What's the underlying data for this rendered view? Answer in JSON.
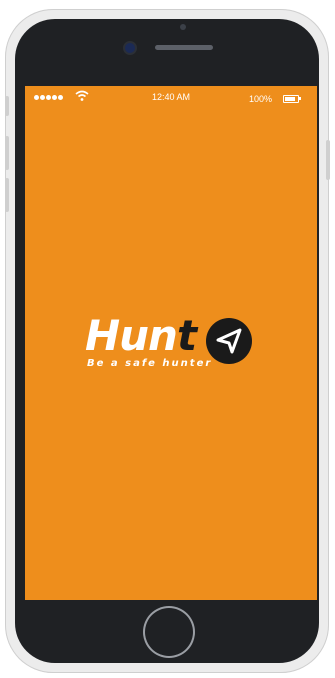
{
  "status_bar": {
    "time": "12:40 AM",
    "battery_text": "100%",
    "signal_bars": 5,
    "icons": [
      "signal-dots-icon",
      "wifi-icon",
      "battery-icon"
    ]
  },
  "app": {
    "logo_part1": "Hun",
    "logo_part2": "t",
    "tagline": "Be a safe hunter",
    "logo_icon": "navigation-arrow-icon"
  },
  "colors": {
    "screen_background": "#ee8e1c",
    "logo_dark": "#1a1a1a",
    "logo_light": "#ffffff",
    "bezel": "#1f2124"
  }
}
